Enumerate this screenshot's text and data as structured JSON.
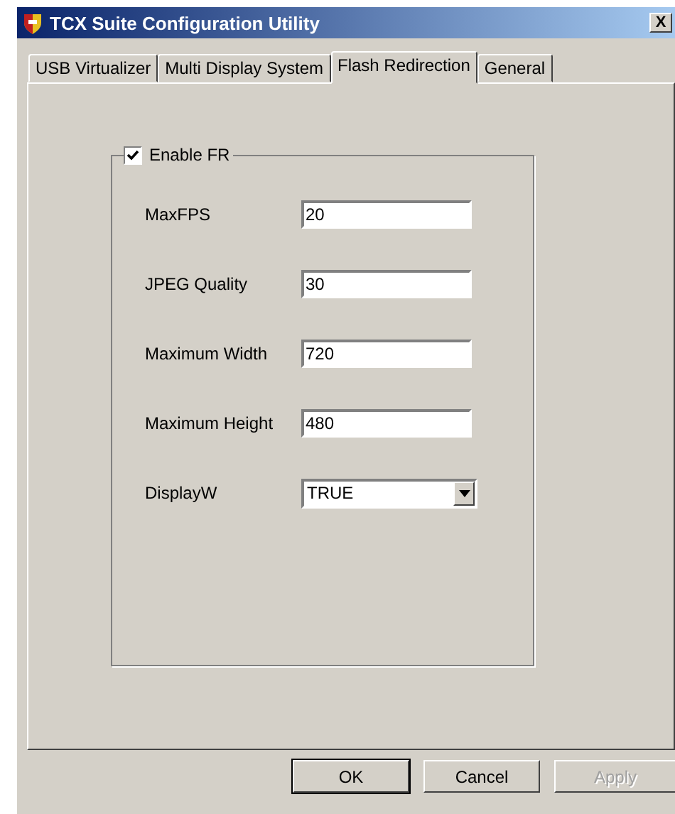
{
  "window": {
    "title": "TCX Suite Configuration Utility",
    "close": "X"
  },
  "tabs": [
    {
      "label": "USB Virtualizer",
      "selected": false
    },
    {
      "label": "Multi Display System",
      "selected": false
    },
    {
      "label": "Flash Redirection",
      "selected": true
    },
    {
      "label": "General",
      "selected": false
    }
  ],
  "group": {
    "label": "Enable FR",
    "checked": true
  },
  "fields": [
    {
      "kind": "text",
      "label": "MaxFPS",
      "value": "20"
    },
    {
      "kind": "text",
      "label": "JPEG Quality",
      "value": "30"
    },
    {
      "kind": "text",
      "label": "Maximum Width",
      "value": "720"
    },
    {
      "kind": "text",
      "label": "Maximum Height",
      "value": "480"
    },
    {
      "kind": "dropdown",
      "label": "DisplayW",
      "value": "TRUE"
    }
  ],
  "buttons": [
    {
      "label": "OK",
      "disabled": false,
      "default": true
    },
    {
      "label": "Cancel",
      "disabled": false,
      "default": false
    },
    {
      "label": "Apply",
      "disabled": true,
      "default": false
    }
  ]
}
